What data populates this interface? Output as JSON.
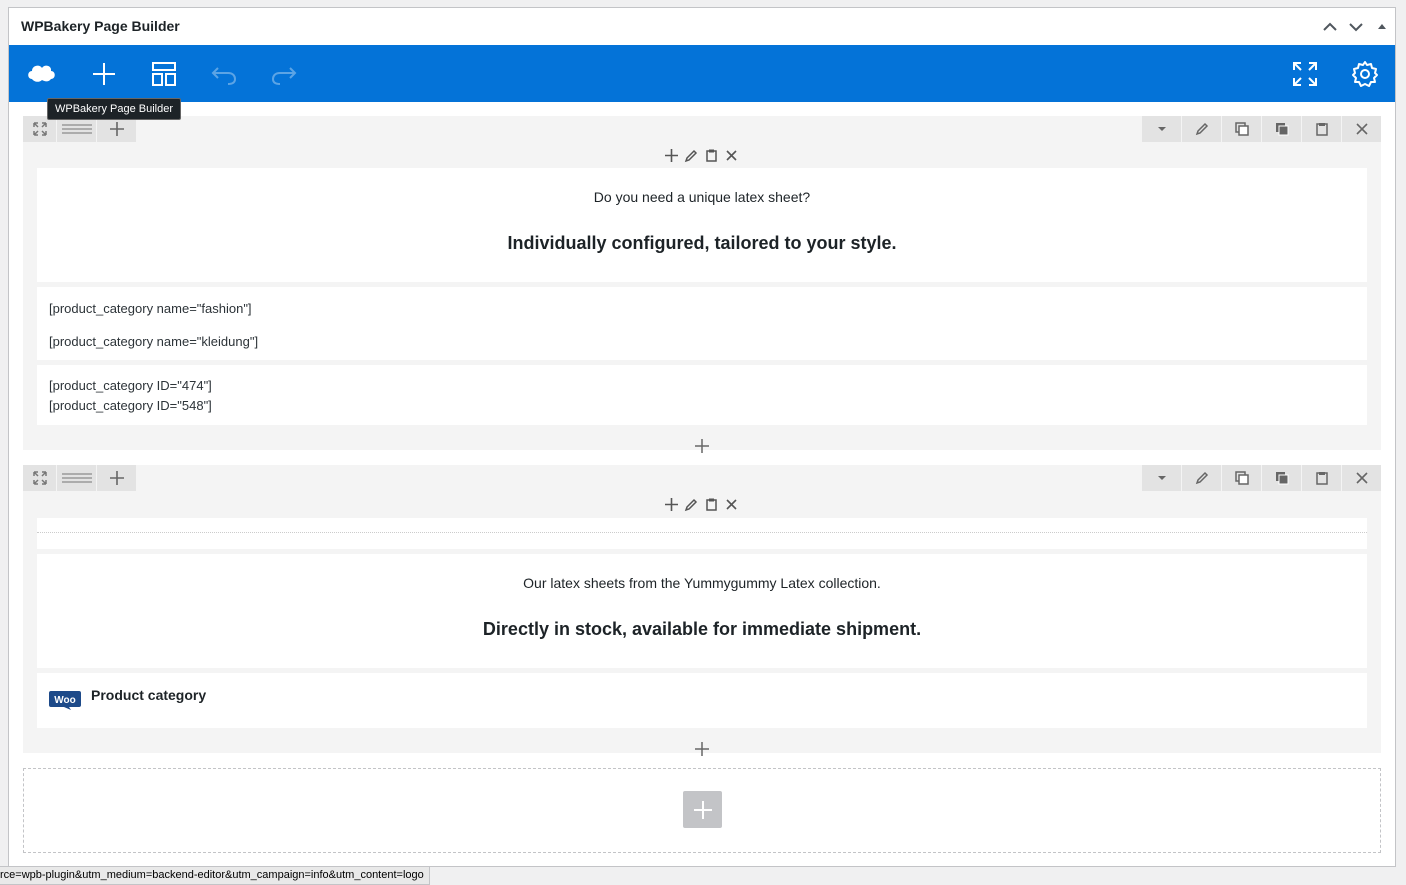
{
  "panel": {
    "title": "WPBakery Page Builder"
  },
  "toolbar": {
    "tooltip": "WPBakery Page Builder",
    "logo_icon": "wpbakery-cloud-icon",
    "add_icon": "plus-icon",
    "templates_icon": "layout-templates-icon",
    "undo_icon": "undo-icon",
    "redo_icon": "redo-icon",
    "fullscreen_icon": "fullscreen-icon",
    "settings_icon": "gear-icon",
    "background": "#0473d8"
  },
  "sections": [
    {
      "elements": [
        {
          "type": "text",
          "line1": "Do you need a unique latex sheet?",
          "line2": "Individually configured, tailored to your style."
        },
        {
          "type": "shortcode",
          "lines": [
            "[product_category name=\"fashion\"]",
            "[product_category name=\"kleidung\"]"
          ]
        },
        {
          "type": "shortcode",
          "lines": [
            "[product_category ID=\"474\"]",
            "[product_category ID=\"548\"]"
          ]
        }
      ]
    },
    {
      "elements": [
        {
          "type": "separator"
        },
        {
          "type": "text",
          "line1": "Our latex sheets from the Yummygummy Latex collection.",
          "line2": "Directly in stock, available for immediate shipment."
        },
        {
          "type": "woo",
          "title": "Product category",
          "logo_text": "Woo"
        }
      ]
    }
  ],
  "status_bar": {
    "url": "rce=wpb-plugin&utm_medium=backend-editor&utm_campaign=info&utm_content=logo"
  },
  "colors": {
    "accent": "#0473d8",
    "woo": "#1d4a89"
  }
}
